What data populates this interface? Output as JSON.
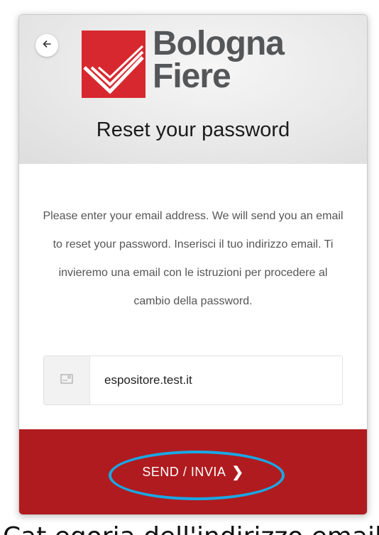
{
  "header": {
    "back_icon": "arrow-left-icon",
    "logo": {
      "line1": "Bologna",
      "line2": "Fiere",
      "mark_color": "#d7282f"
    },
    "title": "Reset your password"
  },
  "form": {
    "instructions": "Please enter your email address. We will send you an email to reset your password. Inserisci il tuo indirizzo email. Ti invieremo una email con le istruzioni per procedere al cambio della password.",
    "email": {
      "icon": "envelope-icon",
      "value": "espositore.test.it"
    }
  },
  "footer": {
    "send_label": "SEND / INVIA",
    "send_icon": "chevron-right-icon",
    "background_color": "#b01b1f"
  },
  "annotation": {
    "color": "#1aa7e4"
  },
  "overlay_caption": "Cat egoria dell'indirizzo email"
}
